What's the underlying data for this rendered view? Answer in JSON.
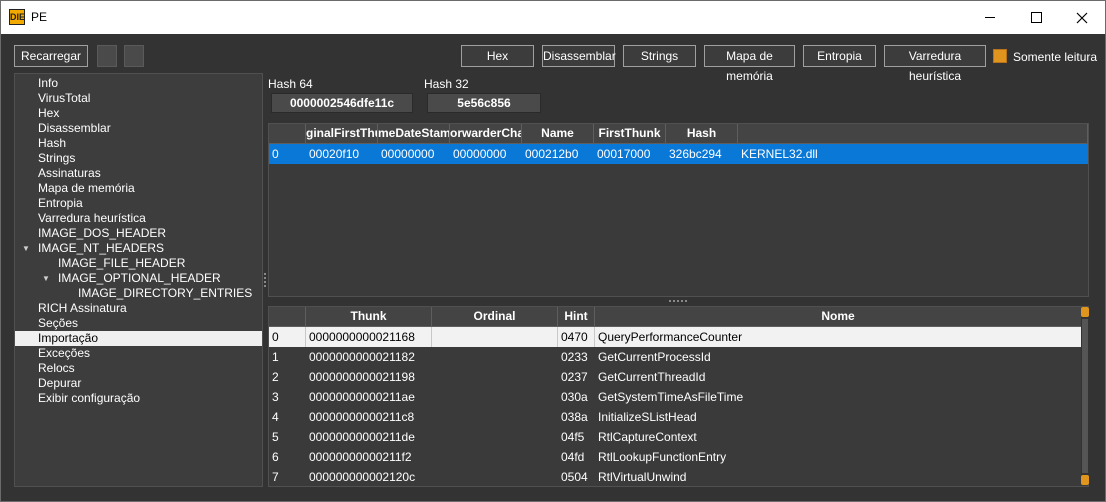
{
  "window": {
    "title": "PE",
    "app_icon": "DIE"
  },
  "toolbar": {
    "reload_label": "Recarregar",
    "buttons": [
      "Hex",
      "Disassemblar",
      "Strings",
      "Mapa de memória",
      "Entropia",
      "Varredura heurística"
    ],
    "readonly_label": "Somente leitura",
    "readonly_checked": true,
    "accent_color": "#e0961e"
  },
  "tree": {
    "items": [
      "Info",
      "VirusTotal",
      "Hex",
      "Disassemblar",
      "Hash",
      "Strings",
      "Assinaturas",
      "Mapa de memória",
      "Entropia",
      "Varredura heurística",
      "IMAGE_DOS_HEADER",
      "IMAGE_NT_HEADERS",
      "IMAGE_FILE_HEADER",
      "IMAGE_OPTIONAL_HEADER",
      "IMAGE_DIRECTORY_ENTRIES",
      "RICH Assinatura",
      "Seções",
      "Importação",
      "Exceções",
      "Relocs",
      "Depurar",
      "Exibir configuração"
    ],
    "selected": "Importação"
  },
  "hash": {
    "hash64_label": "Hash 64",
    "hash64_value": "0000002546dfe11c",
    "hash32_label": "Hash 32",
    "hash32_value": "5e56c856"
  },
  "import_table": {
    "columns": [
      "",
      "ginalFirstThun",
      "meDateStam",
      "orwarderCha",
      "Name",
      "FirstThunk",
      "Hash",
      ""
    ],
    "rows": [
      [
        "0",
        "00020f10",
        "00000000",
        "00000000",
        "000212b0",
        "00017000",
        "326bc294",
        "KERNEL32.dll"
      ]
    ]
  },
  "func_table": {
    "columns": [
      "",
      "Thunk",
      "Ordinal",
      "Hint",
      "Nome"
    ],
    "rows": [
      [
        "0",
        "0000000000021168",
        "",
        "0470",
        "QueryPerformanceCounter"
      ],
      [
        "1",
        "0000000000021182",
        "",
        "0233",
        "GetCurrentProcessId"
      ],
      [
        "2",
        "0000000000021198",
        "",
        "0237",
        "GetCurrentThreadId"
      ],
      [
        "3",
        "00000000000211ae",
        "",
        "030a",
        "GetSystemTimeAsFileTime"
      ],
      [
        "4",
        "00000000000211c8",
        "",
        "038a",
        "InitializeSListHead"
      ],
      [
        "5",
        "00000000000211de",
        "",
        "04f5",
        "RtlCaptureContext"
      ],
      [
        "6",
        "00000000000211f2",
        "",
        "04fd",
        "RtlLookupFunctionEntry"
      ],
      [
        "7",
        "000000000002120c",
        "",
        "0504",
        "RtlVirtualUnwind"
      ]
    ]
  }
}
